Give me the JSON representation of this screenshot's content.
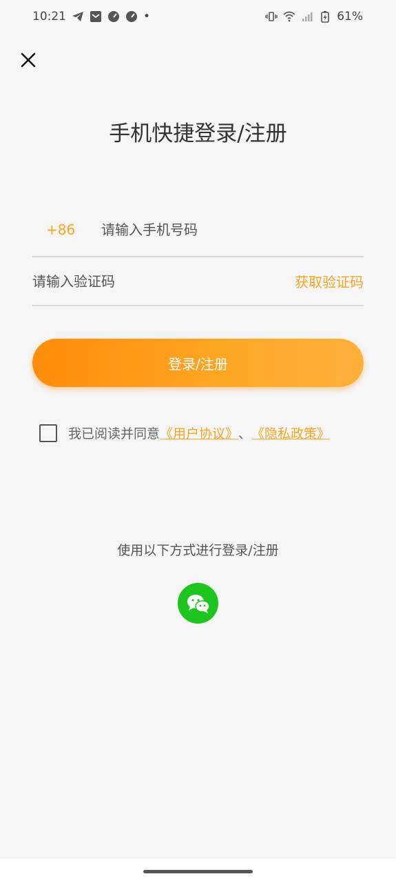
{
  "status_bar": {
    "time": "10:21",
    "dot": "•",
    "battery": "61%",
    "icons": [
      "telegram-icon",
      "message-icon",
      "speed-icon",
      "speed-icon",
      "vibrate-icon",
      "wifi-icon",
      "signal-icon",
      "battery-charging-icon"
    ]
  },
  "page": {
    "title": "手机快捷登录/注册"
  },
  "phone_field": {
    "country_code": "+86",
    "placeholder": "请输入手机号码",
    "value": ""
  },
  "code_field": {
    "placeholder": "请输入验证码",
    "value": "",
    "get_code_label": "获取验证码"
  },
  "login_button": {
    "label": "登录/注册"
  },
  "agreement": {
    "checked": false,
    "prefix": "我已阅读并同意",
    "user_agreement": "《用户协议》",
    "separator": "、",
    "privacy_policy": "《隐私政策》"
  },
  "other_login": {
    "title": "使用以下方式进行登录/注册",
    "methods": [
      "wechat-icon"
    ]
  },
  "colors": {
    "accent": "#f5a623",
    "button_start": "#ff8c0a",
    "button_end": "#ffb03a",
    "wechat": "#1fc51f",
    "background": "#f5f5f5"
  }
}
